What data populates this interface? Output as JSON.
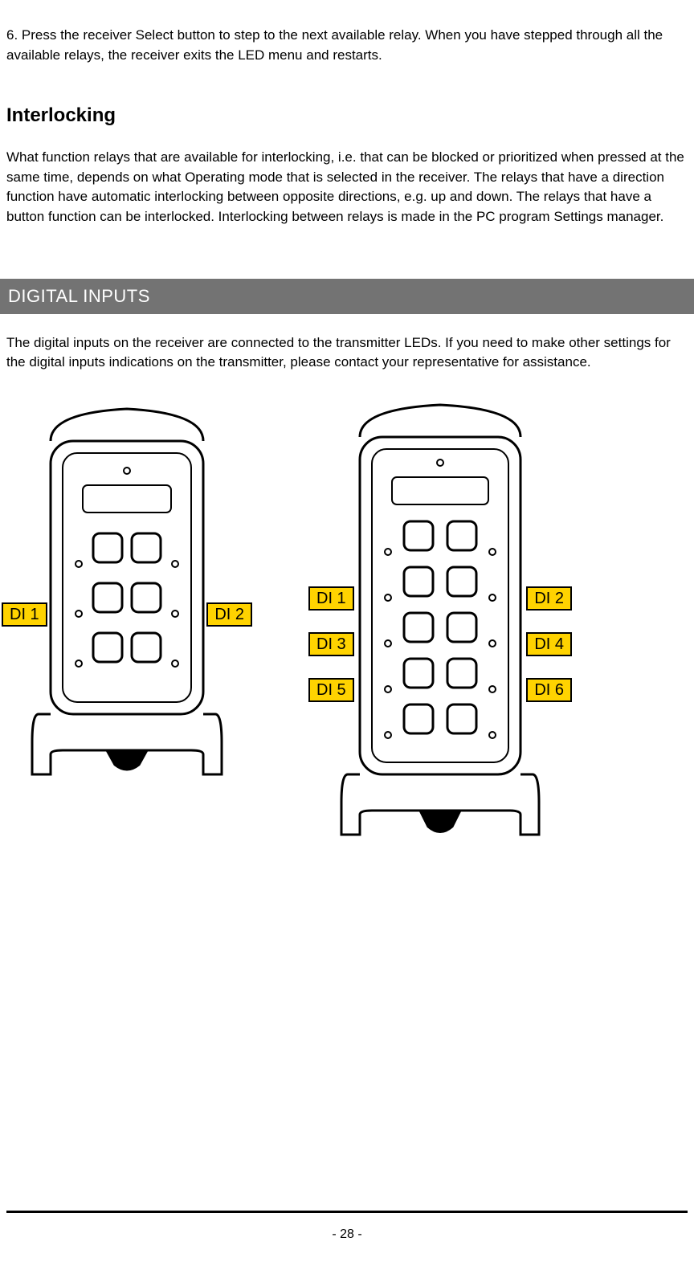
{
  "intro_paragraph": "6. Press the receiver Select button to step to the next available relay. When you have stepped through all the available relays, the receiver exits the LED menu and restarts.",
  "interlocking_heading": "Interlocking",
  "interlocking_text": "What function relays that are available for interlocking, i.e. that can be blocked or prioritized when pressed at the same time, depends on what Operating mode that is selected in the receiver. The relays that have a direction function have automatic interlocking between opposite directions, e.g. up and down. The relays that have a button function can be interlocked. Interlocking between relays is made in the PC program Settings manager.",
  "digital_inputs_heading": "DIGITAL INPUTS",
  "digital_inputs_text": "The digital inputs on the receiver are connected to the transmitter LEDs. If you need to make other settings for the digital inputs indications on the transmitter, please contact your representative for assistance.",
  "labels": {
    "di1": "DI 1",
    "di2": "DI 2",
    "di3": "DI 3",
    "di4": "DI 4",
    "di5": "DI 5",
    "di6": "DI 6"
  },
  "page_number": "- 28 -"
}
